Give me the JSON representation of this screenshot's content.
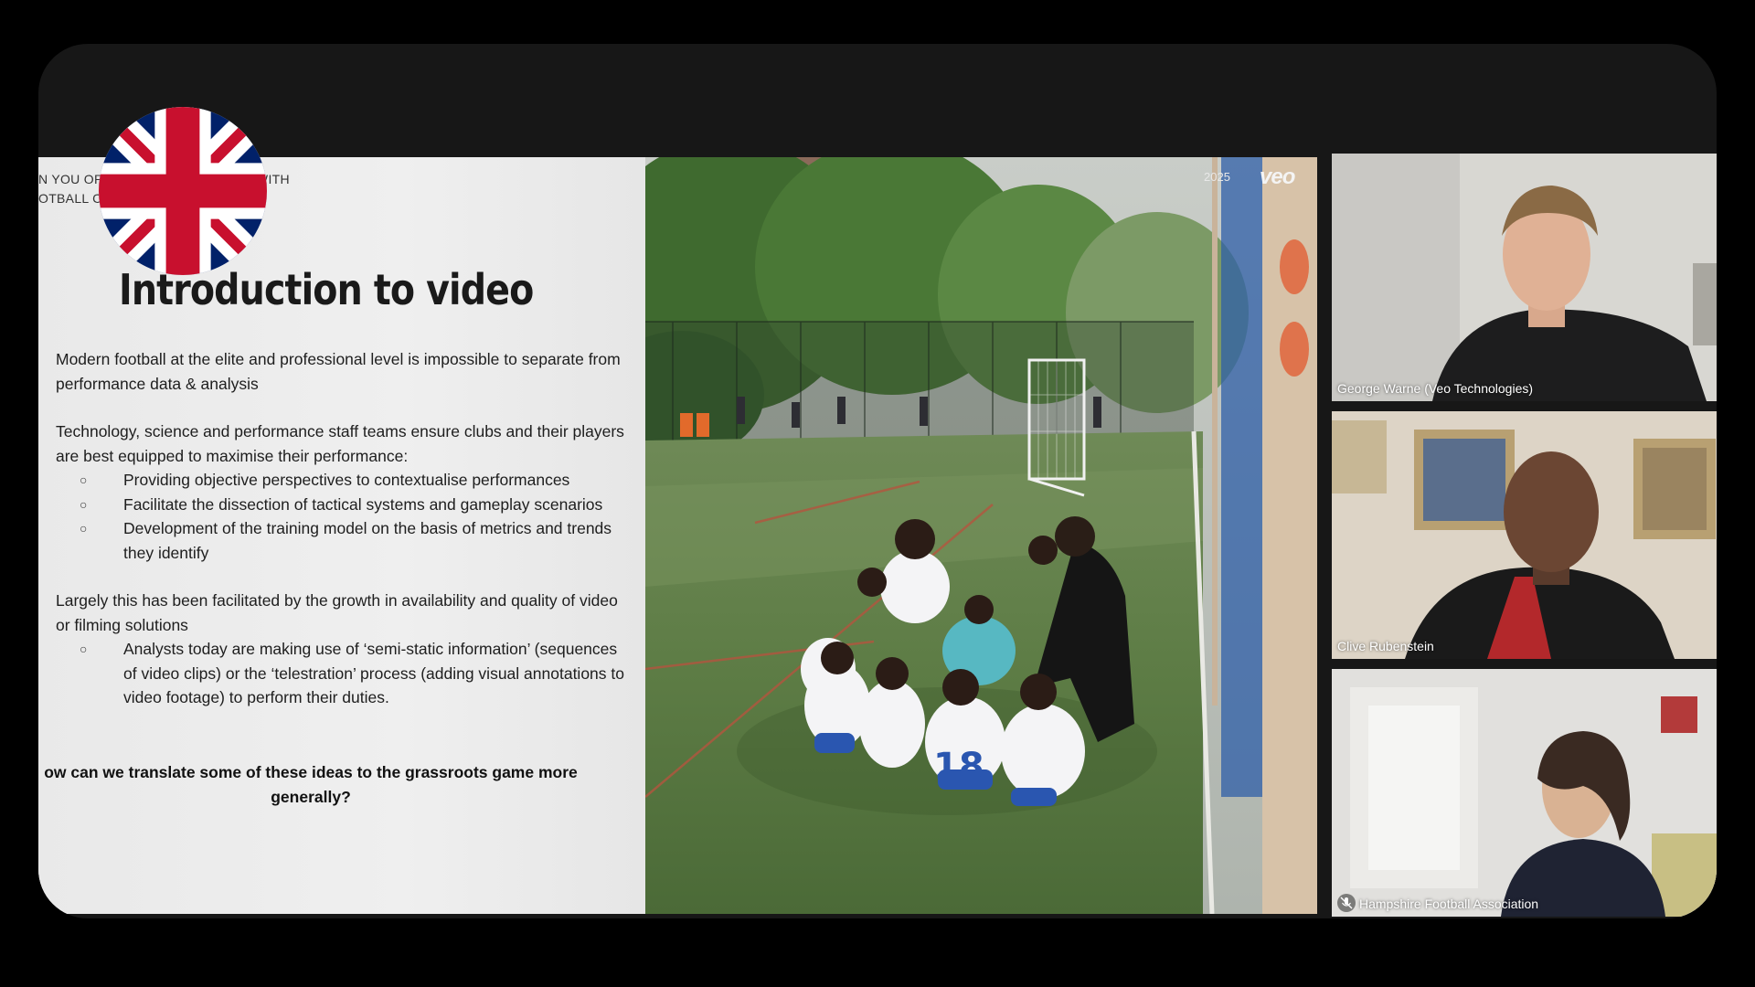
{
  "slide": {
    "caption_line1": "N YOU OP                                        WITH",
    "caption_line2": "OTBALL C",
    "title": "Introduction to video",
    "paragraph1": "Modern football at the elite and professional level is impossible to separate from performance data & analysis",
    "paragraph2": "Technology, science and performance staff teams ensure clubs and their players are best equipped to maximise their performance:",
    "bullets2": [
      "Providing objective perspectives to contextualise performances",
      "Facilitate the dissection of tactical systems and gameplay scenarios",
      "Development of the training model on the basis of metrics and trends they identify"
    ],
    "paragraph3": "Largely this has been facilitated by the growth in availability and quality of video or filming solutions",
    "bullets3": [
      "Analysts today are making use of ‘semi-static information’ (sequences of video clips) or the ‘telestration’ process (adding visual annotations to video footage) to perform their duties."
    ],
    "question": "ow can we translate some of these ideas to the grassroots game more generally?",
    "bullet_symbol": "○",
    "photo_stamp": "2025",
    "photo_logo": "veo"
  },
  "participants": [
    {
      "name": "George Warne (Veo Technologies)"
    },
    {
      "name": "Clive Rubenstein"
    },
    {
      "name": "Hampshire Football Association"
    }
  ],
  "colors": {
    "frame": "#171717",
    "slide_bg": "#ececec",
    "flag_red": "#c8102e",
    "flag_blue": "#012169"
  },
  "icons": {
    "flag": "union-jack-icon",
    "muted": "mic-muted-icon"
  }
}
